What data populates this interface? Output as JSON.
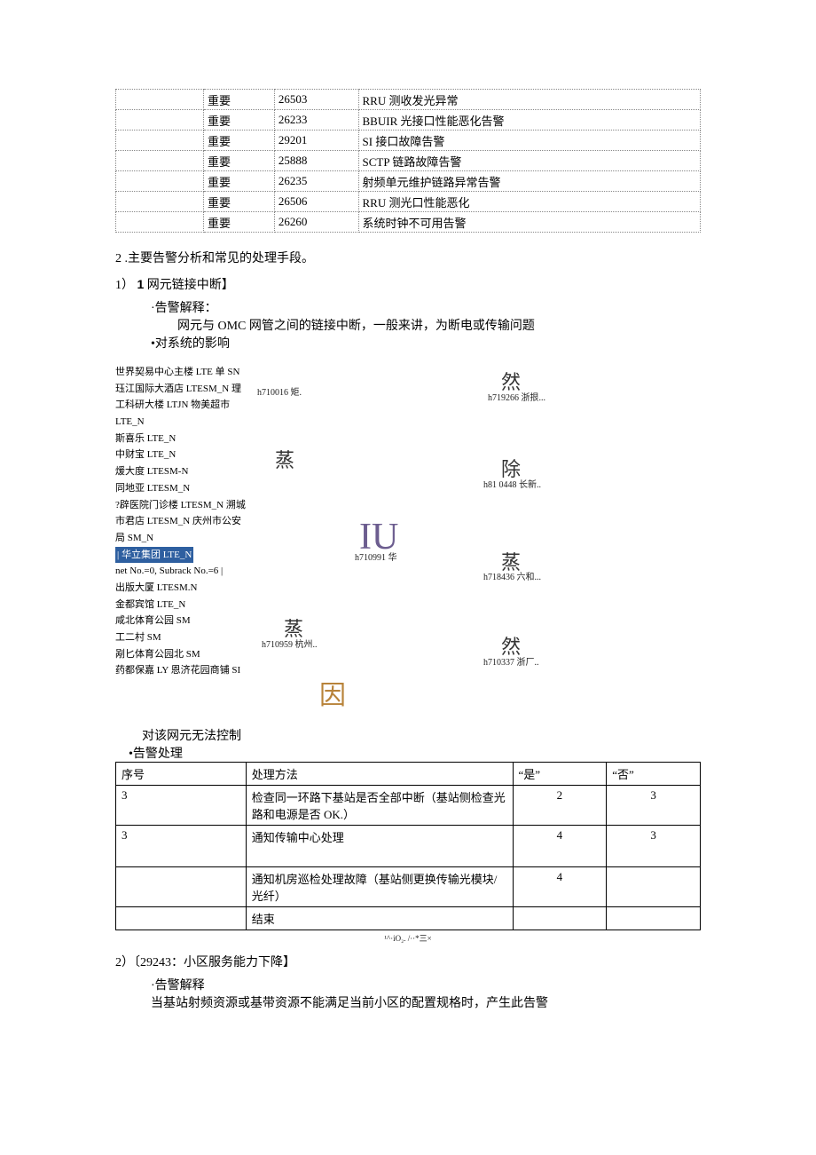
{
  "top_table": {
    "rows": [
      {
        "level": "重要",
        "code": "26503",
        "name": "RRU 测收发光异常"
      },
      {
        "level": "重要",
        "code": "26233",
        "name": "BBUIR 光接口性能恶化告警"
      },
      {
        "level": "重要",
        "code": "29201",
        "name": "SI 接口故障告警"
      },
      {
        "level": "重要",
        "code": "25888",
        "name": "SCTP 链路故障告警"
      },
      {
        "level": "重要",
        "code": "26235",
        "name": "射频单元维护链路异常告警"
      },
      {
        "level": "重要",
        "code": "26506",
        "name": "RRU 测光口性能恶化"
      },
      {
        "level": "重要",
        "code": "26260",
        "name": "系统时钟不可用告警"
      }
    ]
  },
  "section2": "2 .主要告警分析和常见的处理手段。",
  "item1_header_a": "1）",
  "item1_header_b": "1",
  "item1_header_c": " 网元链接中断】",
  "alarm_explain_label": "·告警解释：",
  "alarm_explain_text": "网元与 OMC 网管之间的链接中断，一般来讲，为断电或传输问题",
  "sys_impact_label": "•对系统的影响",
  "list_items": [
    "世界契易中心主楼 LTE 单 SN",
    "珏江国际大酒店 LTESM_N 理",
    "工科研大楼 LTJN 物美超市",
    "LTE_N",
    "斯喜乐 LTE_N",
    "中财宝 LTE_N",
    "煖大度 LTESM-N",
    "同地亚 LTESM_N",
    "?辟医院门诊楼 LTESM_N 溯城",
    "市君店 LTESM_N 庆州市公安",
    "局 SM_N"
  ],
  "list_highlight": "| 华立集团 LTE_N",
  "list_sub": "net No.=0, Subrack No.=6 |",
  "list_items2": [
    "出版大厦 LTESM.N",
    "金都宾馆 LTE_N",
    "咸北体育公园 SM",
    "工二村 SM",
    "剐匕体育公园北 SM",
    "药都保嘉 LY 恩济花园商铺 SI"
  ],
  "deco": {
    "h1": "h710016 矩.",
    "ran1": "然",
    "h2": "h719266 浙拫...",
    "zheng1": "蒸",
    "chu": "除",
    "h3": "h81 0448 长新..",
    "iu": "IU",
    "h4": "h710991 华",
    "zheng2": "蒸",
    "h5": "h718436 六和...",
    "zheng3": "蒸",
    "h6": "h710959 杭州..",
    "ran2": "然",
    "h7": "h710337 浙厂..",
    "yin": "因"
  },
  "no_control": "对该网元无法控制",
  "alarm_handle_label": "•告警处理",
  "proc_table": {
    "headers": [
      "序号",
      "处理方法",
      "“是”",
      "“否”"
    ],
    "rows": [
      {
        "no": "3",
        "method": "检查同一环路下基站是否全部中断（基站侧检查光路和电源是否 OK.）",
        "yes": "2"
      },
      {
        "no": "3",
        "method": "通知传输中心处理",
        "yes": "4"
      },
      {
        "no": "",
        "method": "通知机房巡检处理故障（基站侧更换传输光模块/光纤）",
        "yes": "4"
      },
      {
        "no": "",
        "method": "结束",
        "yes": ""
      }
    ]
  },
  "footnote": "¹^⋅iO₂.  /⋅·*三×",
  "item2_header": "2）〔29243：小区服务能力下降】",
  "alarm_explain_label2": "·告警解释",
  "alarm_explain_text2": "当基站射频资源或基带资源不能满足当前小区的配置规格时，产生此告警"
}
